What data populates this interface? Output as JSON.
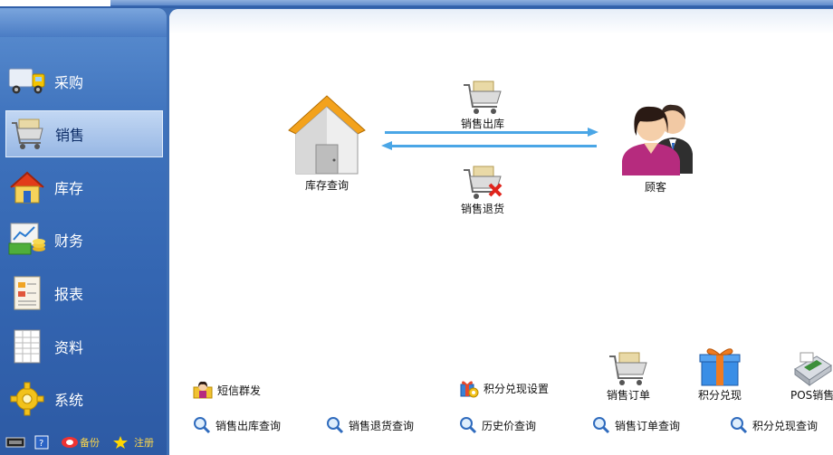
{
  "sidebar": {
    "items": [
      {
        "label": "采购",
        "icon": "truck-icon"
      },
      {
        "label": "销售",
        "icon": "shopping-cart-icon"
      },
      {
        "label": "库存",
        "icon": "house-icon"
      },
      {
        "label": "财务",
        "icon": "money-chart-icon"
      },
      {
        "label": "报表",
        "icon": "report-document-icon"
      },
      {
        "label": "资料",
        "icon": "spreadsheet-icon"
      },
      {
        "label": "系统",
        "icon": "gear-icon"
      }
    ],
    "active_index": 1,
    "footer": {
      "register_label": "注册",
      "backup_label": "备份"
    }
  },
  "main": {
    "flow": {
      "warehouse_label": "库存查询",
      "customer_label": "顾客",
      "sales_out_label": "销售出库",
      "sales_return_label": "销售退货"
    },
    "quick_links": {
      "sms": "短信群发",
      "points_setting": "积分兑现设置",
      "sales_out_query": "销售出库查询",
      "sales_return_query": "销售退货查询",
      "history_price_query": "历史价查询",
      "sales_order_query": "销售订单查询",
      "points_redeem_query": "积分兑现查询"
    },
    "big_buttons": {
      "sales_order": "销售订单",
      "points_redeem": "积分兑现",
      "pos_sales": "POS销售"
    }
  },
  "colors": {
    "sidebar_blue": "#3f73bd",
    "arrow_blue": "#4aa6e6",
    "active_item": "#b0c9ec"
  }
}
